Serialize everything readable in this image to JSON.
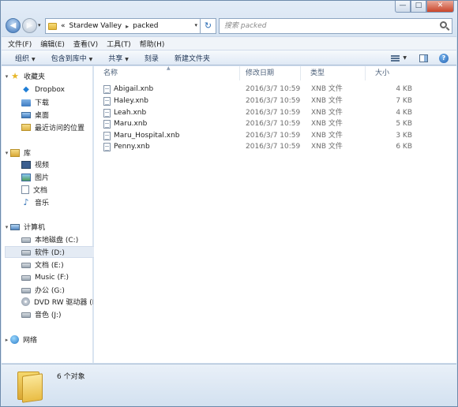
{
  "window": {
    "minimize": "—",
    "maximize": "□",
    "close": "✕"
  },
  "nav": {
    "back": "◀",
    "forward": "▶",
    "history_dropdown": "▾"
  },
  "address": {
    "prefix": "«",
    "crumbs": [
      "Stardew Valley",
      "packed"
    ],
    "separator": "▸",
    "dropdown": "▾",
    "refresh": "↻"
  },
  "search": {
    "placeholder": "搜索 packed"
  },
  "menubar": [
    "文件(F)",
    "编辑(E)",
    "查看(V)",
    "工具(T)",
    "帮助(H)"
  ],
  "toolbar": {
    "organize": "组织",
    "include_in_library": "包含到库中",
    "share": "共享",
    "burn": "刻录",
    "new_folder": "新建文件夹",
    "help": "?"
  },
  "sidebar": {
    "favorites": {
      "label": "收藏夹",
      "items": [
        "Dropbox",
        "下载",
        "桌面",
        "最近访问的位置"
      ]
    },
    "libraries": {
      "label": "库",
      "items": [
        "视频",
        "图片",
        "文档",
        "音乐"
      ]
    },
    "computer": {
      "label": "计算机",
      "items": [
        "本地磁盘 (C:)",
        "软件 (D:)",
        "文档 (E:)",
        "Music (F:)",
        "办公 (G:)",
        "DVD RW 驱动器 (H:",
        "音色 (J:)"
      ],
      "selected_index": 1
    },
    "network": {
      "label": "网络"
    }
  },
  "columns": {
    "name": "名称",
    "date": "修改日期",
    "type": "类型",
    "size": "大小"
  },
  "files": [
    {
      "name": "Abigail.xnb",
      "date": "2016/3/7 10:59",
      "type": "XNB 文件",
      "size": "4 KB"
    },
    {
      "name": "Haley.xnb",
      "date": "2016/3/7 10:59",
      "type": "XNB 文件",
      "size": "7 KB"
    },
    {
      "name": "Leah.xnb",
      "date": "2016/3/7 10:59",
      "type": "XNB 文件",
      "size": "4 KB"
    },
    {
      "name": "Maru.xnb",
      "date": "2016/3/7 10:59",
      "type": "XNB 文件",
      "size": "5 KB"
    },
    {
      "name": "Maru_Hospital.xnb",
      "date": "2016/3/7 10:59",
      "type": "XNB 文件",
      "size": "3 KB"
    },
    {
      "name": "Penny.xnb",
      "date": "2016/3/7 10:59",
      "type": "XNB 文件",
      "size": "6 KB"
    }
  ],
  "status": {
    "item_count": "6 个对象"
  }
}
